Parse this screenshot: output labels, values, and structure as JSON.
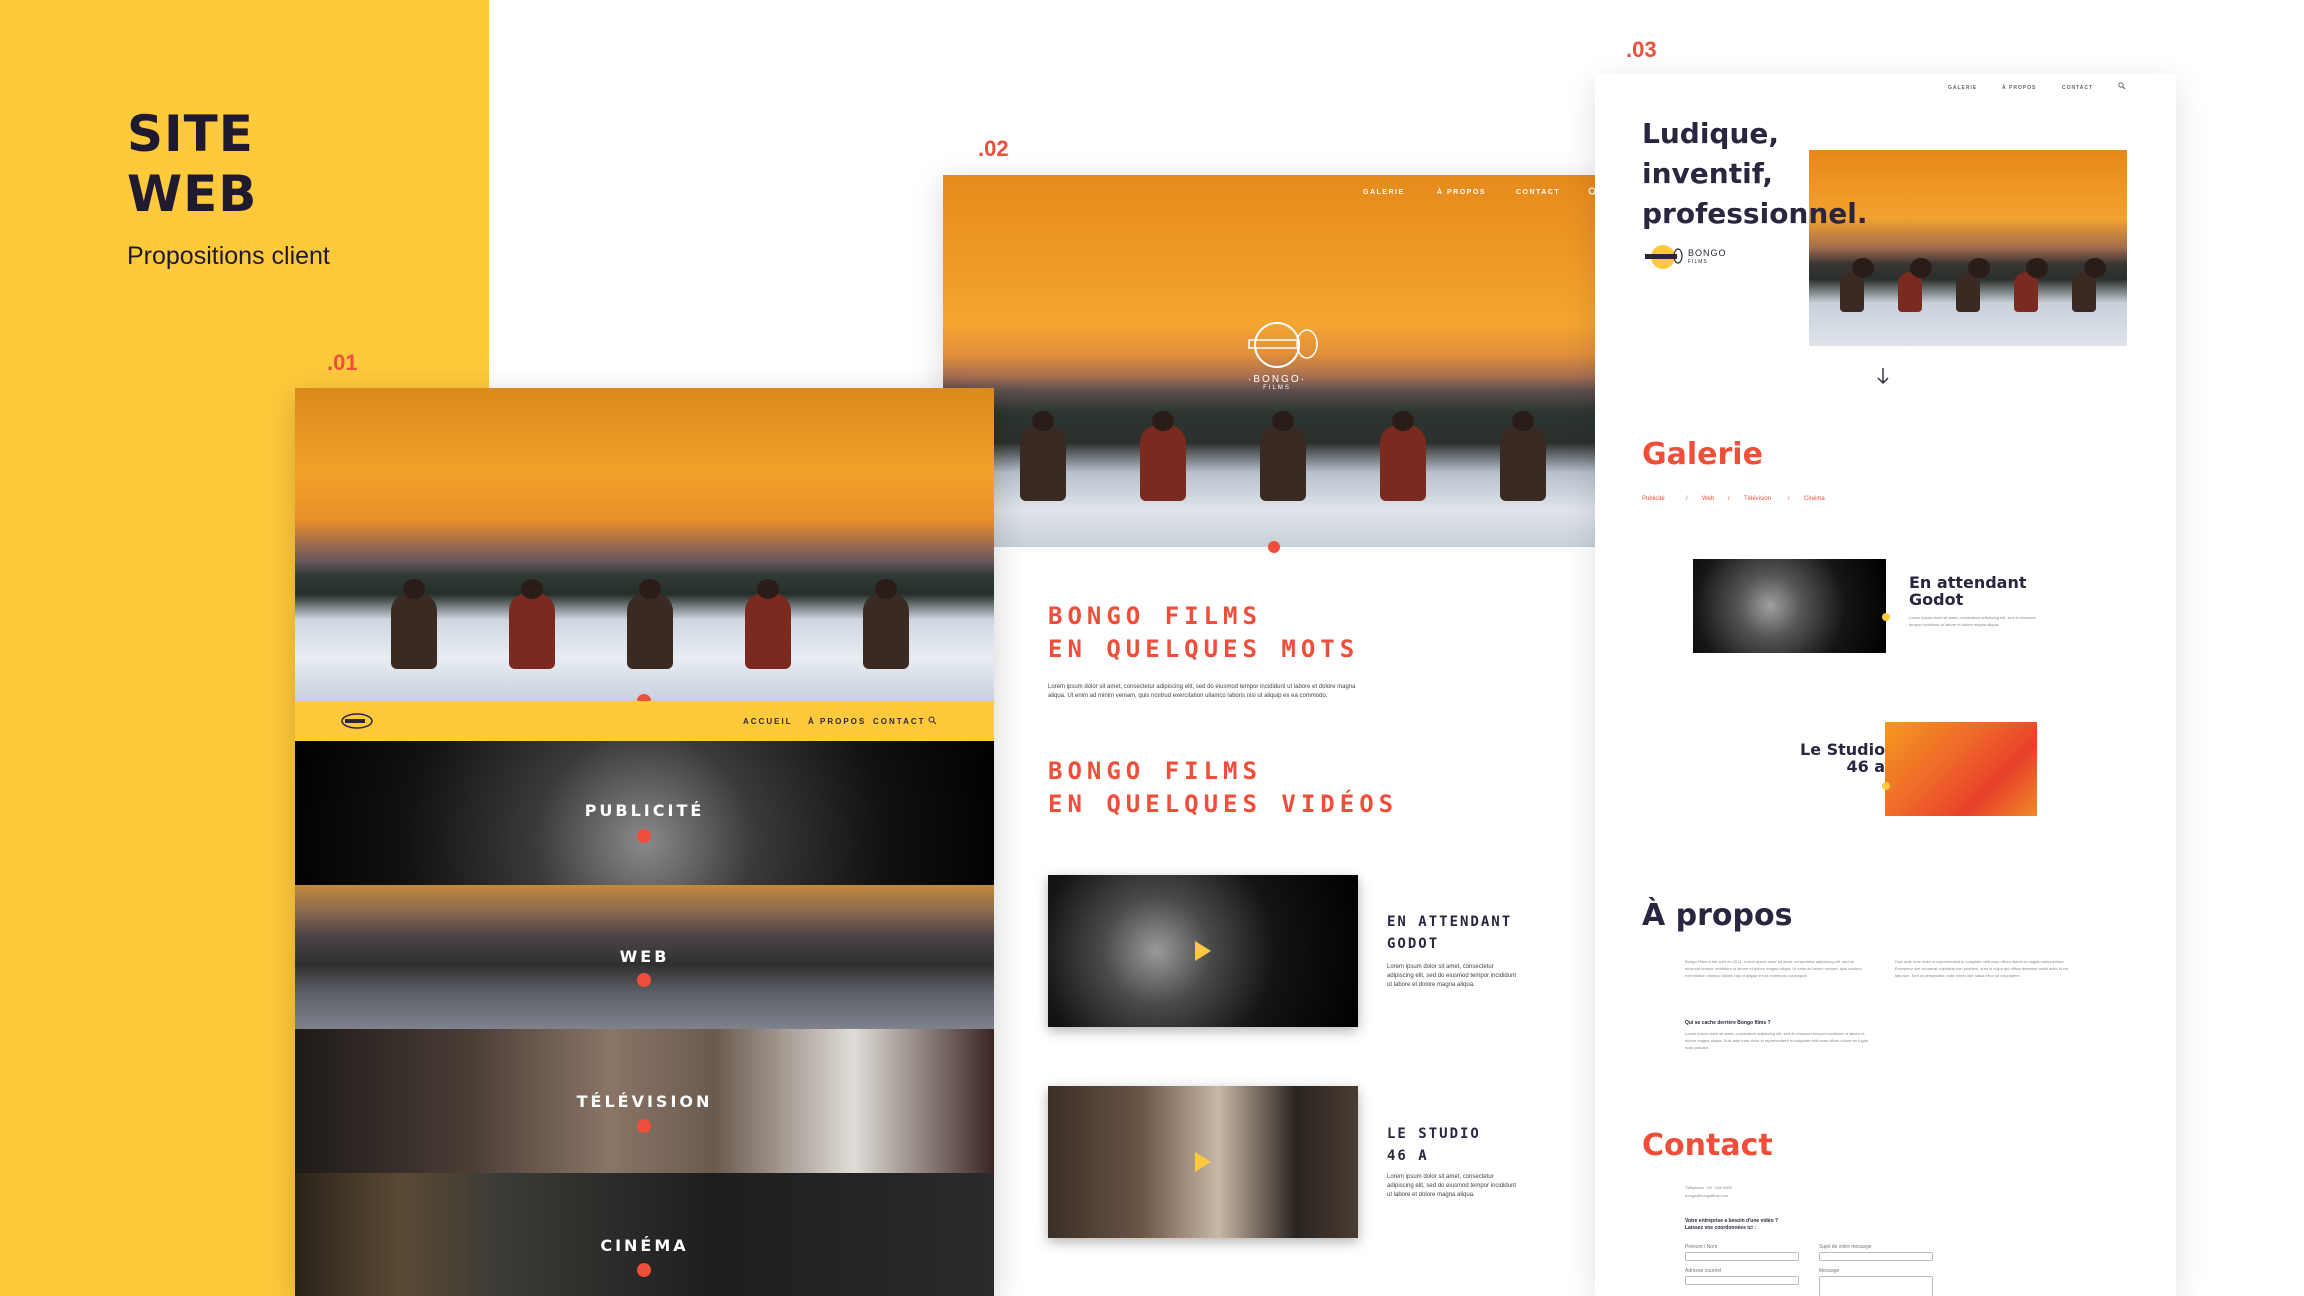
{
  "left_panel": {
    "title_line1": "SITE",
    "title_line2": "WEB",
    "subtitle": "Propositions client",
    "accent_color": "#FFC93C"
  },
  "labels": {
    "v1": ".01",
    "v2": ".02",
    "v3": ".03"
  },
  "mockup1": {
    "nav": [
      "ACCUEIL",
      "À PROPOS",
      "CONTACT"
    ],
    "categories": [
      "PUBLICITÉ",
      "WEB",
      "TÉLÉVISION",
      "CINÉMA"
    ]
  },
  "mockup2": {
    "nav": [
      "GALERIE",
      "À PROPOS",
      "CONTACT"
    ],
    "logo_text": "·BONGO·",
    "logo_sub": "FILMS",
    "section1_line1": "BONGO FILMS",
    "section1_line2": "EN QUELQUES MOTS",
    "section1_body": "Lorem ipsum dolor sit amet, consectetur adipiscing elit, sed do eiusmod tempor incididunt ut labore et dolore magna aliqua. Ut enim ad minim veniam, quis nostrud exercitation ullamco laboris nisi ut aliquip ex ea commodo.",
    "section2_line1": "BONGO FILMS",
    "section2_line2": "EN QUELQUES VIDÉOS",
    "videos": [
      {
        "title_line1": "EN ATTENDANT",
        "title_line2": "GODOT",
        "body": "Lorem ipsum dolor sit amet, consectetur adipiscing elit, sed do eiusmod tempor incididunt ut labore et dolore magna aliqua."
      },
      {
        "title_line1": "LE STUDIO",
        "title_line2": "46 A",
        "body": "Lorem ipsum dolor sit amet, consectetur adipiscing elit, sed do eiusmod tempor incididunt ut labore et dolore magna aliqua."
      }
    ]
  },
  "mockup3": {
    "nav": [
      "GALERIE",
      "À PROPOS",
      "CONTACT"
    ],
    "tagline1": "Ludique,",
    "tagline2": "inventif,",
    "tagline3": "professionnel.",
    "logo_text": "BONGO",
    "logo_sub": "FILMS",
    "galerie": "Galerie",
    "filters": [
      "Publicité",
      "/",
      "Web",
      "/",
      "Télévision",
      "/",
      "Cinéma"
    ],
    "card1_l1": "En attendant",
    "card1_l2": "Godot",
    "card1_body": "Lorem ipsum dolor sit amet, consectetur adipiscing elit, sed do eiusmod tempor incididunt ut labore et dolore magna aliqua.",
    "card2_l1": "Le Studio",
    "card2_l2": "46 a",
    "apropos": "À propos",
    "about_col1": "Bongo Films a été créé en 2011. Lorem ipsum dolor sit amet, consectetur adipiscing elit, sed do eiusmod tempor incididunt ut labore et dolore magna aliqua. Ut enim ad minim veniam, quis nostrud exercitation ullamco laboris nisi ut aliquip ex ea commodo consequat.",
    "about_q": "Qui se cache derrière Bongo films ?",
    "about_col1b": "Lorem ipsum dolor sit amet, consectetur adipiscing elit, sed do eiusmod tempor incididunt ut labore et dolore magna aliqua. Duis aute irure dolor in reprehenderit in voluptate velit esse cillum dolore eu fugiat nulla pariatur.",
    "about_col2": "Duis aute irure dolor in reprehenderit in voluptate velit esse cillum dolore eu fugiat nulla pariatur. Excepteur sint occaecat cupidatat non proident, sunt in culpa qui officia deserunt mollit anim id est laborum. Sed ut perspiciatis unde omnis iste natus error sit voluptatem.",
    "contact": "Contact",
    "contact_info": "Téléphone : 00 · 000 0000",
    "contact_mail": "bongo@bongofilms.com",
    "form_q1": "Votre entreprise a besoin d'une vidéo ?",
    "form_q2": "Laissez vos coordonnées ici :",
    "form_f1": "Prénom / Nom",
    "form_f2": "Sujet de votre message",
    "form_f3": "Adresse courriel",
    "form_f4": "Message"
  },
  "colors": {
    "red": "#EF4E3A",
    "navy": "#2b2540",
    "yellow": "#FFC93C"
  }
}
